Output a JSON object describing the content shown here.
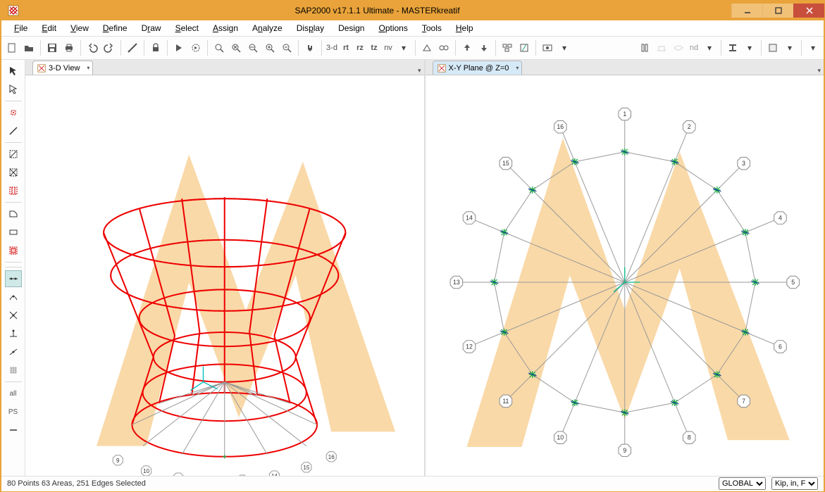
{
  "title": "SAP2000 v17.1.1 Ultimate  -  MASTERkreatif",
  "menus": [
    "File",
    "Edit",
    "View",
    "Define",
    "Draw",
    "Select",
    "Assign",
    "Analyze",
    "Display",
    "Design",
    "Options",
    "Tools",
    "Help"
  ],
  "toolbar_text": {
    "t3d": "3-d",
    "rt": "rt",
    "rz": "rz",
    "tz": "tz",
    "nv": "nv",
    "nd": "nd"
  },
  "tabs": {
    "left": "3-D View",
    "right": "X-Y Plane @ Z=0"
  },
  "statusbar": {
    "text": "80 Points  63 Areas,  251 Edges Selected",
    "coord": "GLOBAL",
    "units": "Kip, in, F"
  },
  "node_labels": [
    "1",
    "2",
    "3",
    "4",
    "5",
    "6",
    "7",
    "8",
    "9",
    "10",
    "11",
    "12",
    "13",
    "14",
    "15",
    "16"
  ],
  "left_tools": [
    "all",
    "PS"
  ]
}
